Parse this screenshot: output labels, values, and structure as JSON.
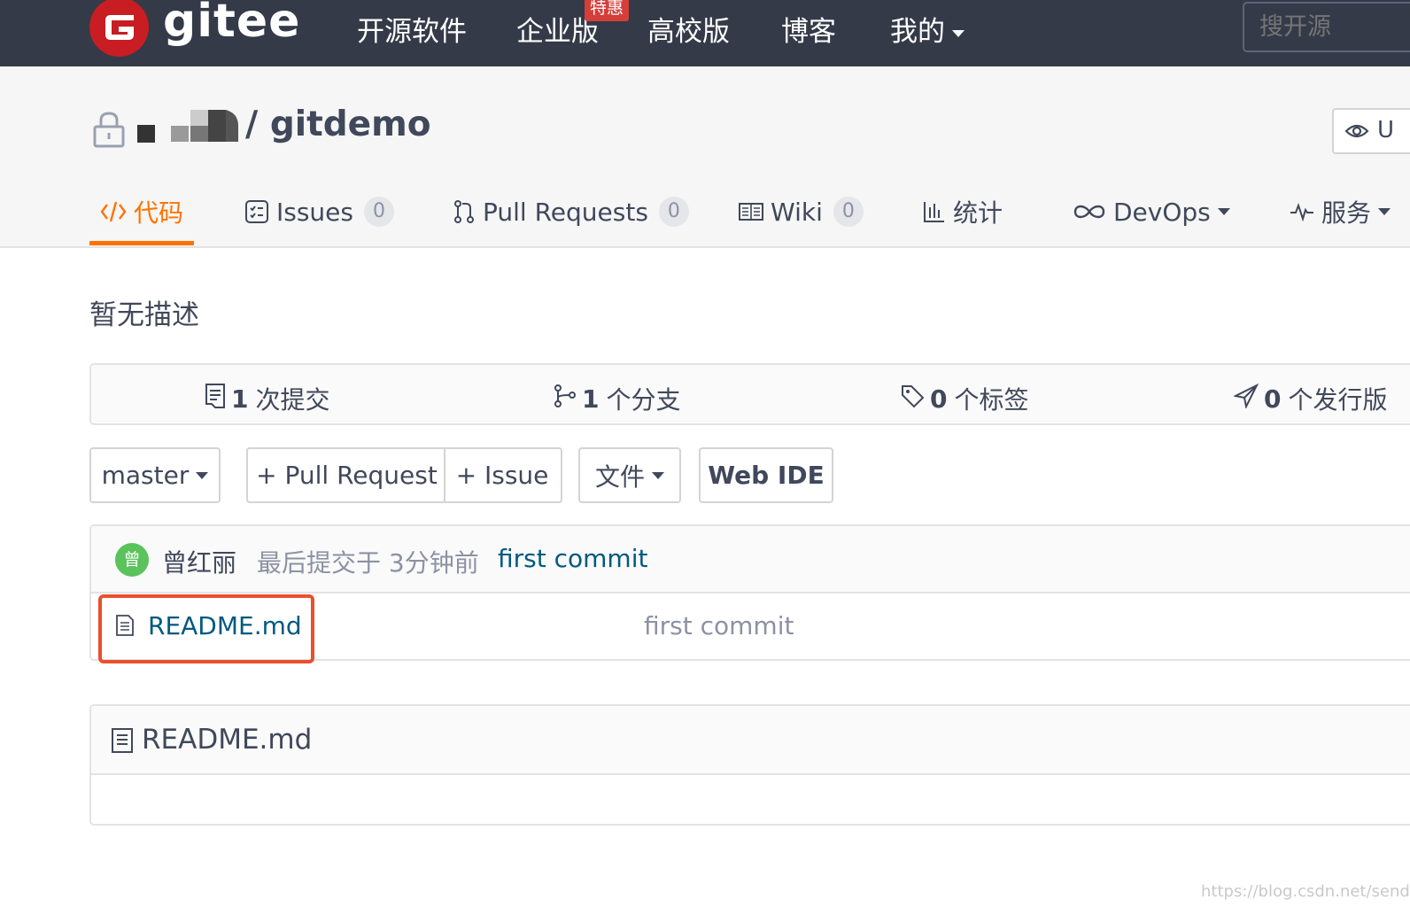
{
  "nav": {
    "logo_text": "gitee",
    "items": [
      "开源软件",
      "企业版",
      "高校版",
      "博客",
      "我的"
    ],
    "promo_badge": "特惠",
    "search_placeholder": "搜开源"
  },
  "project": {
    "name": "/ gitdemo",
    "watch_label": "U"
  },
  "tabs": [
    {
      "label": "代码",
      "count": null,
      "active": true
    },
    {
      "label": "Issues",
      "count": "0"
    },
    {
      "label": "Pull Requests",
      "count": "0"
    },
    {
      "label": "Wiki",
      "count": "0"
    },
    {
      "label": "统计",
      "count": null
    },
    {
      "label": "DevOps",
      "count": null
    },
    {
      "label": "服务",
      "count": null
    }
  ],
  "description": "暂无描述",
  "stats": {
    "commits": {
      "count": "1",
      "label": "次提交"
    },
    "branches": {
      "count": "1",
      "label": "个分支"
    },
    "tags": {
      "count": "0",
      "label": "个标签"
    },
    "releases": {
      "count": "0",
      "label": "个发行版"
    }
  },
  "toolbar": {
    "branch": "master",
    "pull_request": "+ Pull Request",
    "issue": "+ Issue",
    "file": "文件",
    "web_ide": "Web IDE"
  },
  "latest_commit": {
    "avatar_char": "曾",
    "author": "曾红丽",
    "time": "最后提交于 3分钟前",
    "message": "first commit"
  },
  "files": [
    {
      "name": "README.md",
      "commit_message": "first commit"
    }
  ],
  "readme": {
    "title": "README.md"
  },
  "watermark": "https://blog.csdn.net/sendear",
  "colors": {
    "nav_bg": "#343a48",
    "accent_orange": "#fe7300",
    "logo_red": "#c71d23",
    "link_blue": "#005980",
    "highlight_red": "#e8502f"
  }
}
